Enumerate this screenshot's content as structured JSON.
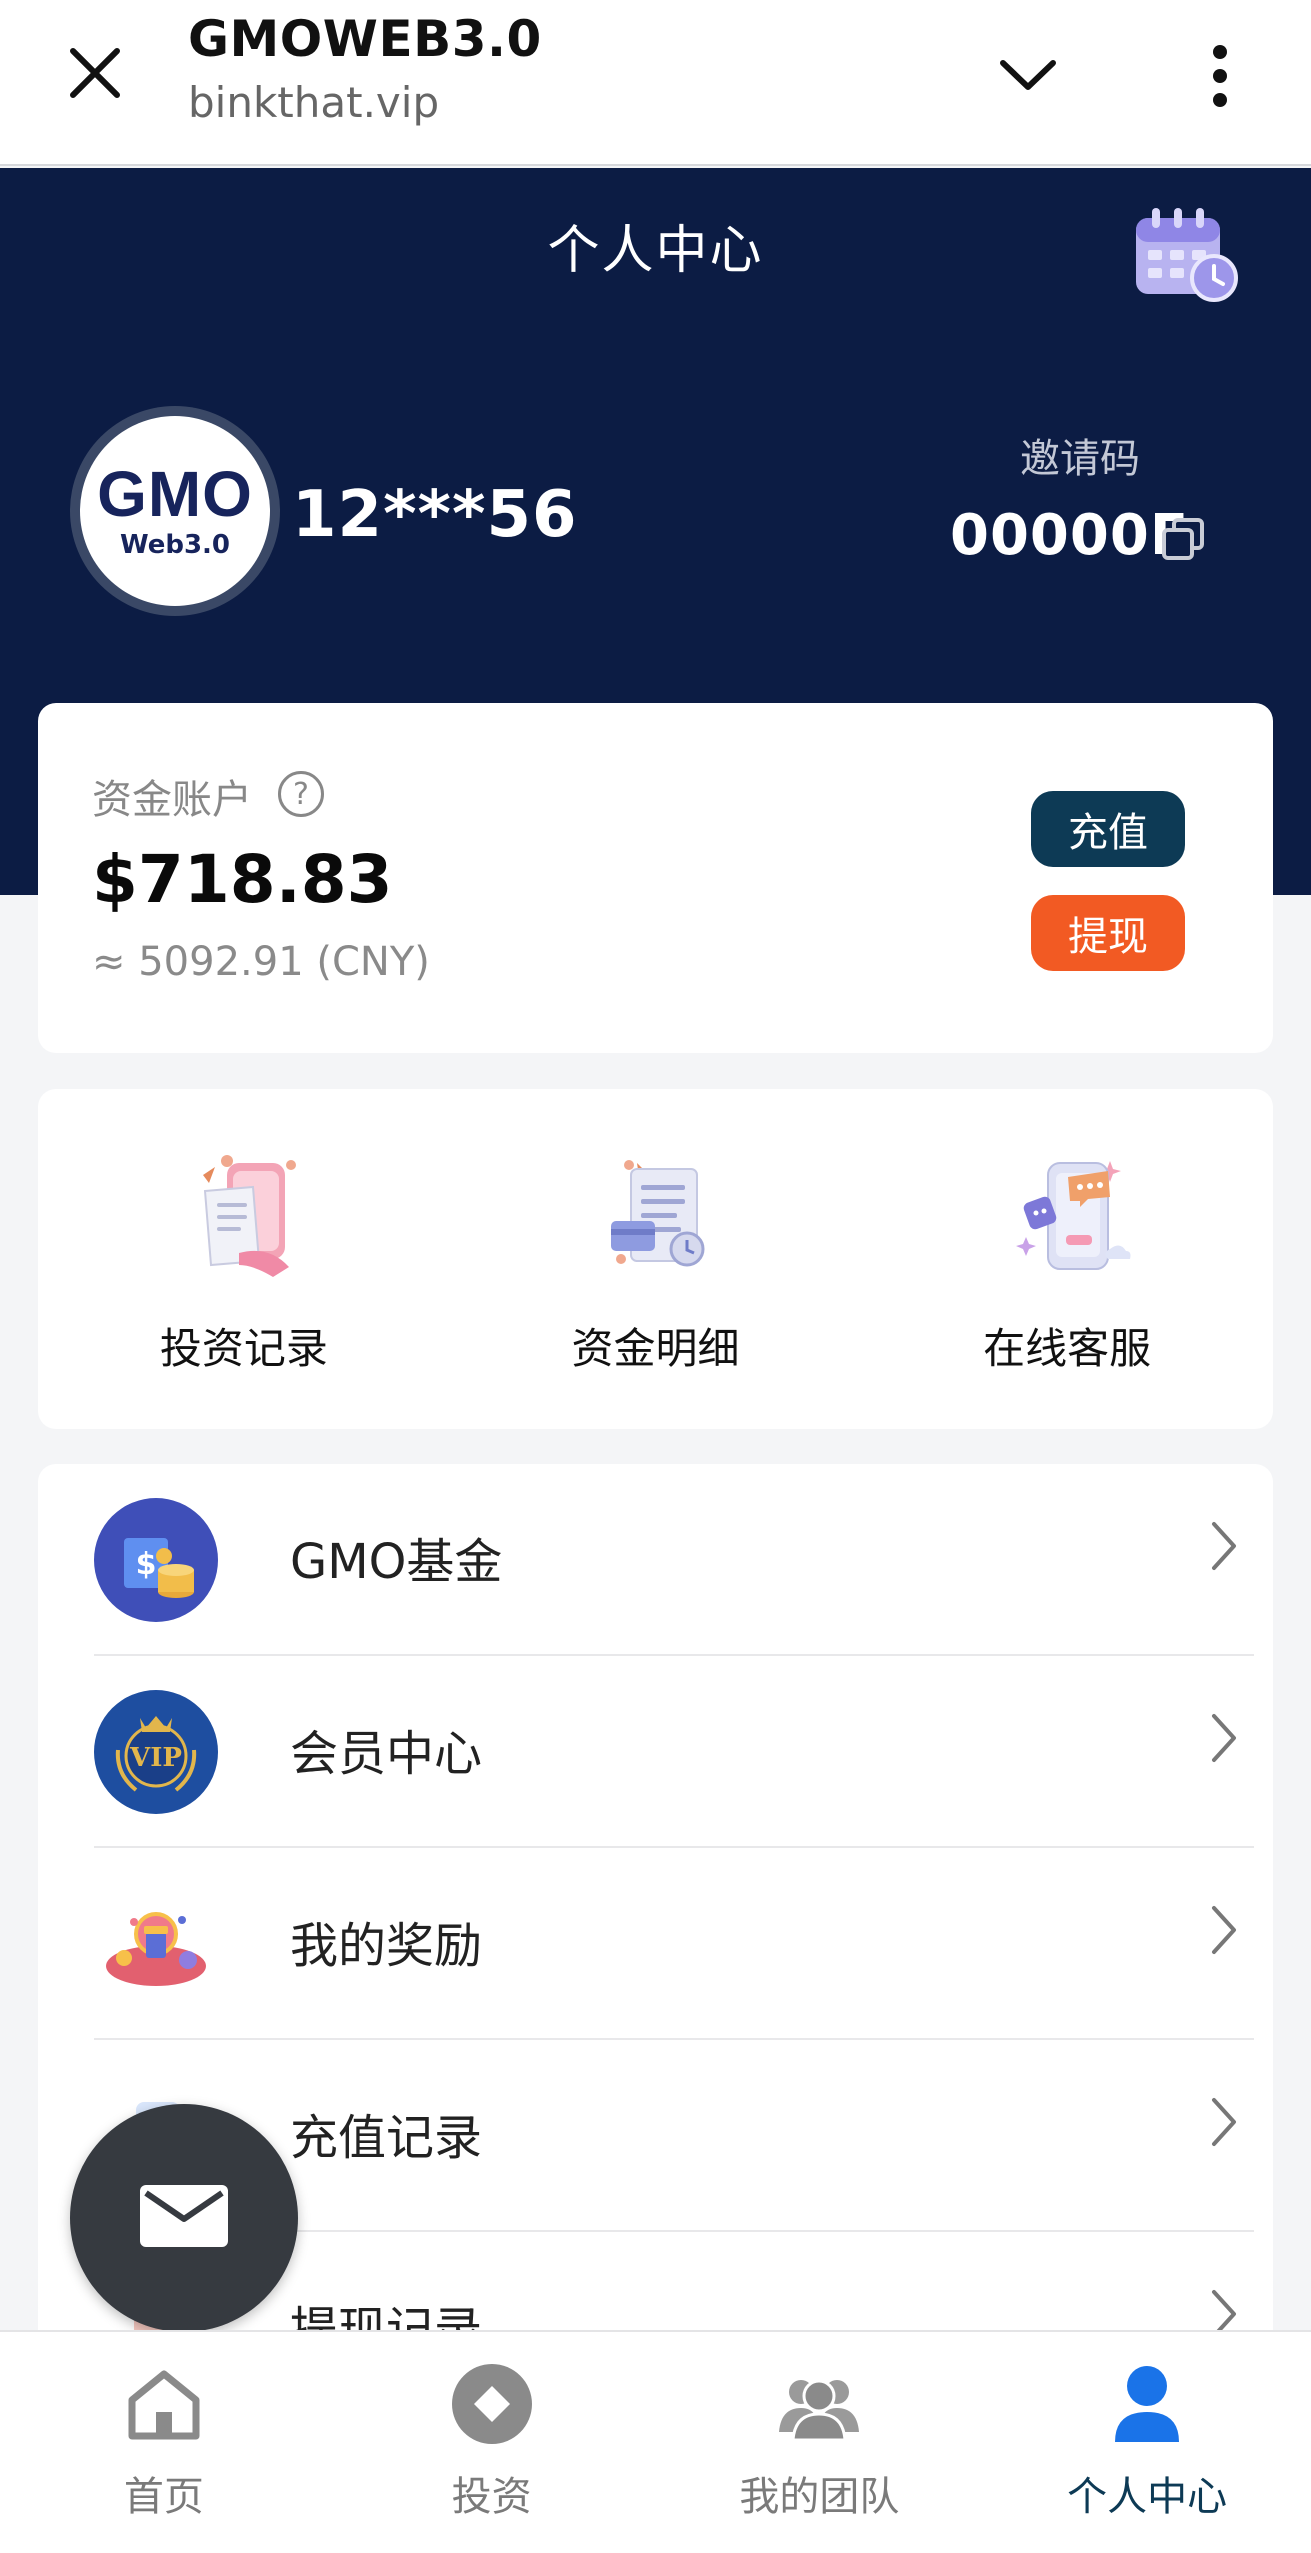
{
  "browser": {
    "title": "GMOWEB3.0",
    "url": "binkthat.vip"
  },
  "header": {
    "title": "个人中心",
    "avatar_text": "GMO",
    "avatar_subtext": "Web3.0",
    "username": "12***56",
    "invite_label": "邀请码",
    "invite_code": "00000F"
  },
  "account": {
    "label": "资金账户",
    "help_symbol": "?",
    "amount": "$718.83",
    "cny": "≈ 5092.91 (CNY)",
    "deposit_label": "充值",
    "withdraw_label": "提现"
  },
  "quick_actions": [
    {
      "label": "投资记录",
      "icon": "invest-record-icon"
    },
    {
      "label": "资金明细",
      "icon": "fund-detail-icon"
    },
    {
      "label": "在线客服",
      "icon": "customer-service-icon"
    }
  ],
  "menu": [
    {
      "label": "GMO基金",
      "icon": "fund-icon"
    },
    {
      "label": "会员中心",
      "icon": "vip-icon"
    },
    {
      "label": "我的奖励",
      "icon": "reward-icon"
    },
    {
      "label": "充值记录",
      "icon": "deposit-record-icon"
    },
    {
      "label": "提现记录",
      "icon": "withdraw-record-icon"
    }
  ],
  "bottom_nav": [
    {
      "label": "首页",
      "icon": "home-icon",
      "active": false
    },
    {
      "label": "投资",
      "icon": "invest-icon",
      "active": false
    },
    {
      "label": "我的团队",
      "icon": "team-icon",
      "active": false
    },
    {
      "label": "个人中心",
      "icon": "profile-icon",
      "active": true
    }
  ],
  "colors": {
    "header_bg": "#0c1c44",
    "deposit_btn": "#0d3a55",
    "withdraw_btn": "#f25a23",
    "active_nav": "#1a73e8"
  }
}
